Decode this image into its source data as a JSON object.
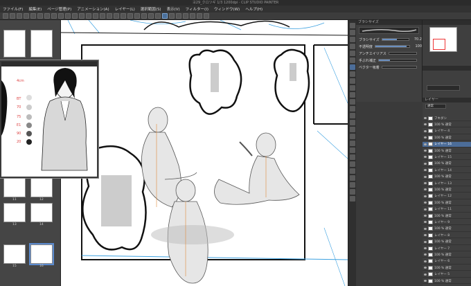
{
  "window": {
    "title": "ヨ29_クロツギ 1/3 1200dpi · CLIP STUDIO PAINTER"
  },
  "menu": [
    "ファイル(F)",
    "編集(E)",
    "ページ管理(P)",
    "アニメーション(A)",
    "レイヤー(L)",
    "選択範囲(S)",
    "表示(V)",
    "フィルター(I)",
    "ウィンドウ(W)",
    "ヘルプ(H)"
  ],
  "toolprops": {
    "header": "ブラシサイズ",
    "rows": [
      {
        "label": "ブラシサイズ",
        "value": "70.2",
        "fill": 0.55
      },
      {
        "label": "不透明度",
        "value": "100",
        "fill": 0.9
      },
      {
        "label": "アンチエイリアス",
        "value": "",
        "fill": 0.0
      },
      {
        "label": "手ぶれ補正",
        "value": "",
        "fill": 0.3
      },
      {
        "label": "ベクター吸着",
        "value": "",
        "fill": 0.0
      }
    ]
  },
  "layers": {
    "header": "レイヤー",
    "blend": "通常",
    "items": [
      {
        "name": "フキダシ",
        "sel": false
      },
      {
        "name": "100 % 通常",
        "sel": false
      },
      {
        "name": "レイヤー 4",
        "sel": false
      },
      {
        "name": "100 % 通常",
        "sel": false
      },
      {
        "name": "レイヤー 16",
        "sel": true
      },
      {
        "name": "100 % 通常",
        "sel": false
      },
      {
        "name": "レイヤー 15",
        "sel": false
      },
      {
        "name": "100 % 通常",
        "sel": false
      },
      {
        "name": "レイヤー 14",
        "sel": false
      },
      {
        "name": "100 % 通常",
        "sel": false
      },
      {
        "name": "レイヤー 13",
        "sel": false
      },
      {
        "name": "100 % 通常",
        "sel": false
      },
      {
        "name": "レイヤー 12",
        "sel": false
      },
      {
        "name": "100 % 通常",
        "sel": false
      },
      {
        "name": "レイヤー 11",
        "sel": false
      },
      {
        "name": "100 % 通常",
        "sel": false
      },
      {
        "name": "レイヤー 9",
        "sel": false
      },
      {
        "name": "100 % 通常",
        "sel": false
      },
      {
        "name": "レイヤー 8",
        "sel": false
      },
      {
        "name": "100 % 通常",
        "sel": false
      },
      {
        "name": "レイヤー 7",
        "sel": false
      },
      {
        "name": "100 % 通常",
        "sel": false
      },
      {
        "name": "レイヤー 6",
        "sel": false
      },
      {
        "name": "100 % 通常",
        "sel": false
      },
      {
        "name": "レイヤー 5",
        "sel": false
      },
      {
        "name": "100 % 通常",
        "sel": false
      }
    ]
  },
  "pages": [
    {
      "num": "",
      "sel": false
    },
    {
      "num": "",
      "sel": false
    },
    {
      "num": "",
      "sel": false
    },
    {
      "num": "",
      "sel": false
    },
    {
      "num": "11",
      "sel": false
    },
    {
      "num": "12",
      "sel": false
    },
    {
      "num": "13",
      "sel": false
    },
    {
      "num": "14",
      "sel": false
    },
    {
      "num": "15",
      "sel": false
    },
    {
      "num": "16",
      "sel": true
    }
  ],
  "colors": {
    "accent": "#4c6d99",
    "bluesketch": "#3aa0e0",
    "canvas": "#ffffff"
  }
}
